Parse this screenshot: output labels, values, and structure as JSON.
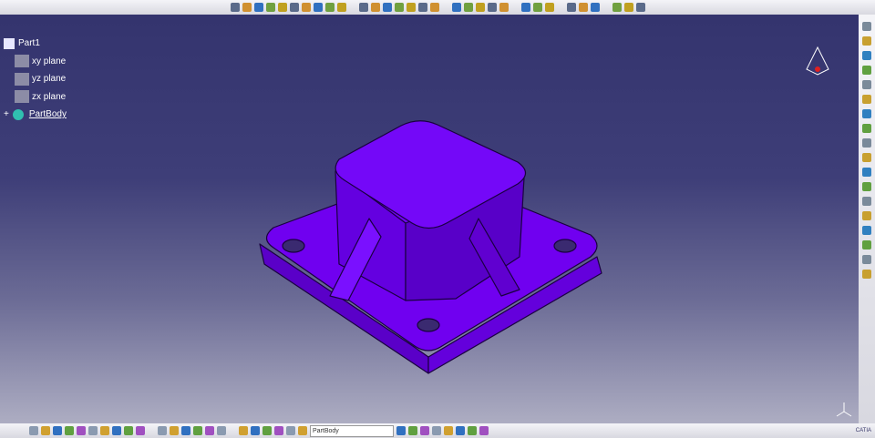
{
  "tree": {
    "root": "Part1",
    "items": [
      "xy plane",
      "yz plane",
      "zx plane"
    ],
    "body": "PartBody"
  },
  "bottom_toolbar": {
    "body_select": "PartBody"
  },
  "brand": "CATIA",
  "colors": {
    "part": "#7000f0",
    "edge": "#1a0040"
  }
}
